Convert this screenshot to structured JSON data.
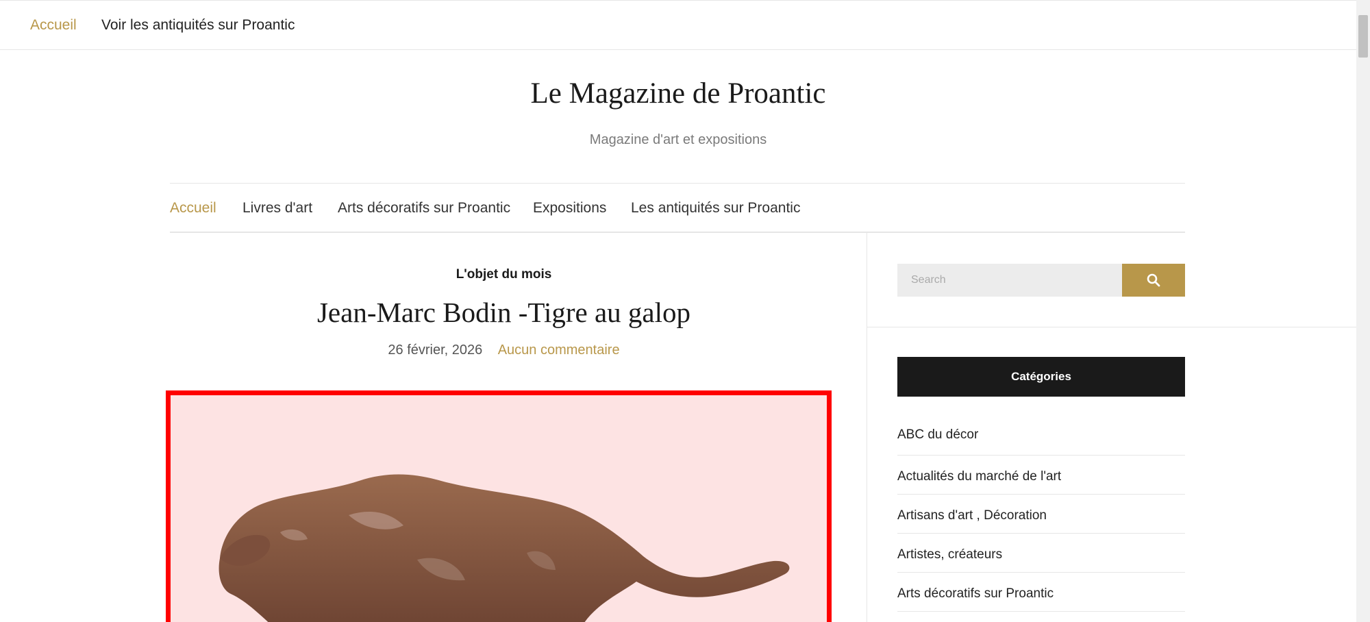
{
  "topbar": {
    "items": [
      {
        "label": "Accueil"
      },
      {
        "label": "Voir les antiquités sur Proantic"
      }
    ]
  },
  "header": {
    "title": "Le Magazine de Proantic",
    "tagline": "Magazine d'art et expositions"
  },
  "nav": {
    "items": [
      {
        "label": "Accueil"
      },
      {
        "label": "Livres d'art"
      },
      {
        "label": "Arts décoratifs sur Proantic"
      },
      {
        "label": "Expositions"
      },
      {
        "label": "Les antiquités sur Proantic"
      }
    ]
  },
  "post": {
    "category": "L'objet du mois",
    "title": "Jean-Marc Bodin -Tigre au galop",
    "date": "26 février, 2026",
    "comments": "Aucun commentaire"
  },
  "sidebar": {
    "search_placeholder": "Search",
    "search_icon": "search-icon",
    "categories_title": "Catégories",
    "categories": [
      "ABC du décor",
      "Actualités du marché de l'art",
      "Artisans d'art , Décoration",
      "Artistes, créateurs",
      "Arts décoratifs sur Proantic"
    ]
  },
  "colors": {
    "accent": "#b8974a",
    "widget_header": "#1a1a1a",
    "image_frame": "#ff0000",
    "image_background": "#fde3e3"
  }
}
